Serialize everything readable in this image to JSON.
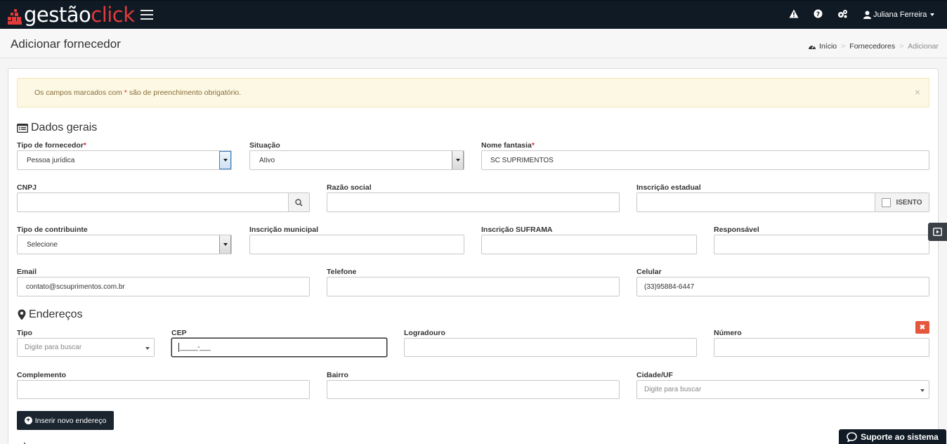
{
  "topbar": {
    "logo_part1": "gestão",
    "logo_part2": "click",
    "user_name": "Juliana Ferreira",
    "icons": [
      "menu-icon",
      "warning-icon",
      "help-icon",
      "cogs-icon",
      "user-icon"
    ]
  },
  "header": {
    "title": "Adicionar fornecedor",
    "breadcrumb": [
      "Início",
      "Fornecedores",
      "Adicionar"
    ]
  },
  "alert": {
    "text_before": "Os campos marcados com",
    "star": "*",
    "text_after": "são de preenchimento obrigatório.",
    "close": "×"
  },
  "general": {
    "title": "Dados gerais",
    "fields": {
      "tipo_fornecedor": {
        "label": "Tipo de fornecedor",
        "value": "Pessoa jurídica",
        "required": "*"
      },
      "situacao": {
        "label": "Situação",
        "value": "Ativo"
      },
      "nome_fantasia": {
        "label": "Nome fantasia",
        "value": "SC SUPRIMENTOS",
        "required": "*"
      },
      "cnpj": {
        "label": "CNPJ",
        "value": ""
      },
      "razao_social": {
        "label": "Razão social",
        "value": ""
      },
      "inscricao_estadual": {
        "label": "Inscrição estadual",
        "value": "",
        "isento_label": "ISENTO"
      },
      "tipo_contribuinte": {
        "label": "Tipo de contribuinte",
        "value": "Selecione"
      },
      "inscricao_municipal": {
        "label": "Inscrição municipal",
        "value": ""
      },
      "inscricao_suframa": {
        "label": "Inscrição SUFRAMA",
        "value": ""
      },
      "responsavel": {
        "label": "Responsável",
        "value": ""
      },
      "email": {
        "label": "Email",
        "value": "contato@scsuprimentos.com.br"
      },
      "telefone": {
        "label": "Telefone",
        "value": ""
      },
      "celular": {
        "label": "Celular",
        "value": "(33)95884-6447"
      }
    }
  },
  "addresses": {
    "title": "Endereços",
    "fields": {
      "tipo": {
        "label": "Tipo",
        "placeholder": "Digite para buscar"
      },
      "cep": {
        "label": "CEP",
        "value": "_____-___"
      },
      "logradouro": {
        "label": "Logradouro",
        "value": ""
      },
      "numero": {
        "label": "Número",
        "value": ""
      },
      "complemento": {
        "label": "Complemento",
        "value": ""
      },
      "bairro": {
        "label": "Bairro",
        "value": ""
      },
      "cidade_uf": {
        "label": "Cidade/UF",
        "placeholder": "Digite para buscar"
      }
    },
    "remove_icon": "✖",
    "add_button": "Inserir novo endereço"
  },
  "support_button": "Suporte ao sistema",
  "colors": {
    "topbar_bg": "#101a24",
    "brand_red": "#e13b3b",
    "alert_bg": "#fcf8e3",
    "alert_text": "#8a6d3b",
    "danger": "#e5573c",
    "dark_button": "#1b2530"
  }
}
